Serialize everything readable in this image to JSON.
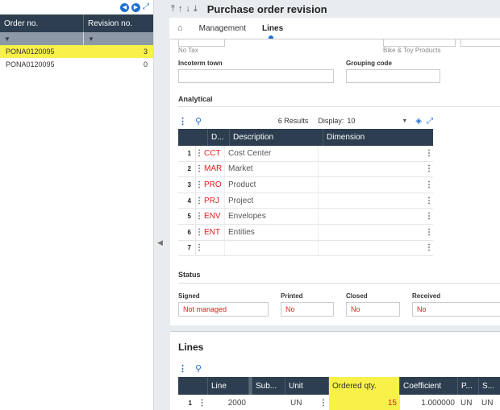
{
  "left": {
    "headers": {
      "order": "Order no.",
      "revision": "Revision no."
    },
    "rows": [
      {
        "order": "PONA0120095",
        "revision": "3",
        "selected": true
      },
      {
        "order": "PONA0120095",
        "revision": "0",
        "selected": false
      }
    ]
  },
  "header": {
    "title": "Purchase order revision"
  },
  "tabs": [
    {
      "label": "Management",
      "active": false
    },
    {
      "label": "Lines",
      "active": true
    }
  ],
  "form": {
    "tax_hint": "No Tax",
    "company_hint": "Bike & Toy Products",
    "incoterm_town_label": "Incoterm town",
    "incoterm_town_value": "",
    "grouping_code_label": "Grouping code",
    "grouping_code_value": ""
  },
  "analytical": {
    "section_label": "Analytical",
    "results_text": "6 Results",
    "display_label": "Display:",
    "display_value": "10",
    "columns": {
      "code": "D...",
      "description": "Description",
      "dimension": "Dimension"
    },
    "rows": [
      {
        "num": "1",
        "code": "CCT",
        "description": "Cost Center",
        "dimension": ""
      },
      {
        "num": "2",
        "code": "MAR",
        "description": "Market",
        "dimension": ""
      },
      {
        "num": "3",
        "code": "PRO",
        "description": "Product",
        "dimension": ""
      },
      {
        "num": "4",
        "code": "PRJ",
        "description": "Project",
        "dimension": ""
      },
      {
        "num": "5",
        "code": "ENV",
        "description": "Envelopes",
        "dimension": ""
      },
      {
        "num": "6",
        "code": "ENT",
        "description": "Entities",
        "dimension": ""
      },
      {
        "num": "7",
        "code": "",
        "description": "",
        "dimension": ""
      }
    ]
  },
  "status": {
    "section_label": "Status",
    "signed_label": "Signed",
    "signed_value": "Not managed",
    "printed_label": "Printed",
    "printed_value": "No",
    "closed_label": "Closed",
    "closed_value": "No",
    "received_label": "Received",
    "received_value": "No"
  },
  "lines": {
    "title": "Lines",
    "columns": {
      "line": "Line",
      "sub": "Sub...",
      "unit": "Unit",
      "ordered": "Ordered qty.",
      "coef": "Coefficient",
      "p": "P...",
      "s": "S..."
    },
    "rows": [
      {
        "num": "1",
        "line": "2000",
        "sub": "",
        "unit": "UN",
        "ordered": "15",
        "coef": "1.000000",
        "p": "UN",
        "s": "UN"
      }
    ]
  },
  "colors": {
    "accent": "#1f6fd1",
    "header_bg": "#2d3e50",
    "highlight": "#f8f14a",
    "code_red": "#e02020"
  }
}
